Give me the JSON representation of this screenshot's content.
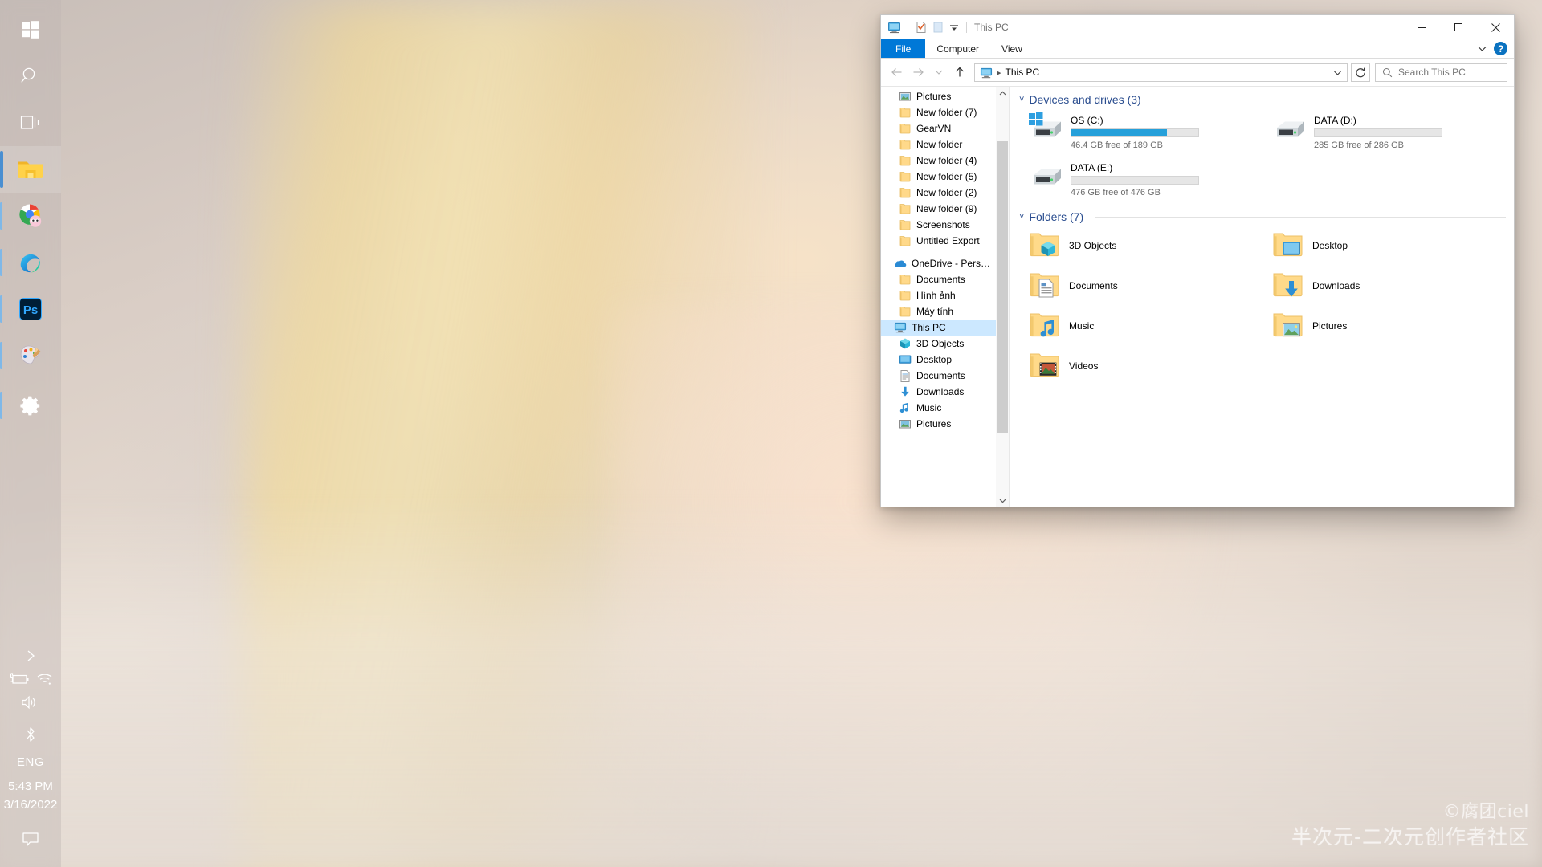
{
  "desktop": {
    "watermark_line1": "©腐团ciel",
    "watermark_line2": "半次元-二次元创作者社区"
  },
  "taskbar": {
    "items": [
      {
        "name": "start-button",
        "icon": "windows-logo-icon",
        "label": "Start",
        "state": "none"
      },
      {
        "name": "search-button",
        "icon": "search-icon",
        "label": "Search",
        "state": "none"
      },
      {
        "name": "task-view-button",
        "icon": "task-view-icon",
        "label": "Task View",
        "state": "none"
      },
      {
        "name": "file-explorer-button",
        "icon": "folder-icon",
        "label": "File Explorer",
        "state": "active"
      },
      {
        "name": "chrome-button",
        "icon": "chrome-icon",
        "label": "Google Chrome",
        "state": "running"
      },
      {
        "name": "edge-button",
        "icon": "edge-icon",
        "label": "Microsoft Edge",
        "state": "running"
      },
      {
        "name": "photoshop-button",
        "icon": "photoshop-icon",
        "label": "Adobe Photoshop",
        "state": "running"
      },
      {
        "name": "paint3d-button",
        "icon": "paint-palette-icon",
        "label": "Paint 3D",
        "state": "running"
      },
      {
        "name": "settings-button",
        "icon": "gear-icon",
        "label": "Settings",
        "state": "running"
      }
    ],
    "tray": {
      "overflow_label": "Show hidden icons",
      "battery_icon": "battery-charging-icon",
      "network_icon": "wifi-icon",
      "volume_icon": "speaker-icon",
      "bluetooth_icon": "bluetooth-icon",
      "language": "ENG",
      "time": "5:43 PM",
      "date": "3/16/2022",
      "action_center_icon": "speech-bubble-icon"
    }
  },
  "explorer": {
    "titlebar": {
      "title": "This PC",
      "quick_access": [
        {
          "name": "this-pc-icon",
          "label": "This PC"
        },
        {
          "name": "properties-icon",
          "label": "Properties"
        },
        {
          "name": "new-folder-icon",
          "label": "New folder"
        },
        {
          "name": "customize-qat-icon",
          "label": "Customize Quick Access Toolbar"
        }
      ],
      "minimize_label": "Minimize",
      "maximize_label": "Maximize",
      "close_label": "Close"
    },
    "ribbon": {
      "tabs": [
        {
          "label": "File",
          "active_file": true
        },
        {
          "label": "Computer",
          "active_file": false
        },
        {
          "label": "View",
          "active_file": false
        }
      ],
      "expand_label": "Expand the Ribbon",
      "help_label": "?"
    },
    "addressbar": {
      "back_label": "Back",
      "forward_label": "Forward",
      "recent_label": "Recent locations",
      "up_label": "Up",
      "breadcrumb": [
        "This PC"
      ],
      "breadcrumb_icon": "this-pc-icon",
      "dropdown_label": "Previous locations",
      "refresh_label": "Refresh",
      "search_placeholder": "Search This PC",
      "search_value": ""
    },
    "navpane": {
      "items": [
        {
          "label": "Pictures",
          "icon": "pictures-icon",
          "pinned": true,
          "indent": 1,
          "selected": false
        },
        {
          "label": "New folder (7)",
          "icon": "folder-icon",
          "pinned": true,
          "indent": 1,
          "selected": false
        },
        {
          "label": "GearVN",
          "icon": "folder-icon",
          "pinned": true,
          "indent": 1,
          "selected": false
        },
        {
          "label": "New folder",
          "icon": "folder-icon",
          "pinned": true,
          "indent": 1,
          "selected": false
        },
        {
          "label": "New folder (4)",
          "icon": "folder-icon",
          "pinned": true,
          "indent": 1,
          "selected": false
        },
        {
          "label": "New folder (5)",
          "icon": "folder-icon",
          "pinned": true,
          "indent": 1,
          "selected": false
        },
        {
          "label": "New folder (2)",
          "icon": "folder-icon",
          "pinned": false,
          "indent": 1,
          "selected": false
        },
        {
          "label": "New folder (9)",
          "icon": "folder-icon",
          "pinned": false,
          "indent": 1,
          "selected": false
        },
        {
          "label": "Screenshots",
          "icon": "folder-icon",
          "pinned": false,
          "indent": 1,
          "selected": false
        },
        {
          "label": "Untitled Export",
          "icon": "folder-icon",
          "pinned": false,
          "indent": 1,
          "selected": false
        },
        {
          "label": "",
          "icon": "spacer",
          "pinned": false,
          "indent": 0,
          "selected": false
        },
        {
          "label": "OneDrive - Personal",
          "icon": "onedrive-icon",
          "pinned": false,
          "indent": 0,
          "selected": false
        },
        {
          "label": "Documents",
          "icon": "folder-icon",
          "pinned": false,
          "indent": 1,
          "selected": false
        },
        {
          "label": "Hình ảnh",
          "icon": "folder-icon",
          "pinned": false,
          "indent": 1,
          "selected": false
        },
        {
          "label": "Máy tính",
          "icon": "folder-icon",
          "pinned": false,
          "indent": 1,
          "selected": false
        },
        {
          "label": "This PC",
          "icon": "this-pc-icon",
          "pinned": false,
          "indent": 0,
          "selected": true
        },
        {
          "label": "3D Objects",
          "icon": "3d-objects-icon",
          "pinned": false,
          "indent": 1,
          "selected": false
        },
        {
          "label": "Desktop",
          "icon": "desktop-icon",
          "pinned": false,
          "indent": 1,
          "selected": false
        },
        {
          "label": "Documents",
          "icon": "documents-icon",
          "pinned": false,
          "indent": 1,
          "selected": false
        },
        {
          "label": "Downloads",
          "icon": "downloads-icon",
          "pinned": false,
          "indent": 1,
          "selected": false
        },
        {
          "label": "Music",
          "icon": "music-icon",
          "pinned": false,
          "indent": 1,
          "selected": false
        },
        {
          "label": "Pictures",
          "icon": "pictures-icon",
          "pinned": false,
          "indent": 1,
          "selected": false
        }
      ],
      "scroll_up_label": "Scroll up",
      "scroll_down_label": "Scroll down"
    },
    "content": {
      "drives_group": {
        "title": "Devices and drives (3)",
        "drives": [
          {
            "name": "OS (C:)",
            "icon": "windows-drive-icon",
            "free_text": "46.4 GB free of 189 GB",
            "used_percent": 75
          },
          {
            "name": "DATA (D:)",
            "icon": "drive-icon",
            "free_text": "285 GB free of 286 GB",
            "used_percent": 0
          },
          {
            "name": "DATA (E:)",
            "icon": "drive-icon",
            "free_text": "476 GB free of 476 GB",
            "used_percent": 0
          }
        ]
      },
      "folders_group": {
        "title": "Folders (7)",
        "folders": [
          {
            "label": "3D Objects",
            "icon": "3d-objects-folder-icon"
          },
          {
            "label": "Desktop",
            "icon": "desktop-folder-icon"
          },
          {
            "label": "Documents",
            "icon": "documents-folder-icon"
          },
          {
            "label": "Downloads",
            "icon": "downloads-folder-icon"
          },
          {
            "label": "Music",
            "icon": "music-folder-icon"
          },
          {
            "label": "Pictures",
            "icon": "pictures-folder-icon"
          },
          {
            "label": "Videos",
            "icon": "videos-folder-icon"
          }
        ]
      }
    }
  },
  "colors": {
    "accent_blue": "#0078d7",
    "drive_bar_blue": "#26a0da",
    "group_header_blue": "#2a4d8f",
    "selection_blue": "#cce8ff",
    "close_red": "#e81123"
  }
}
